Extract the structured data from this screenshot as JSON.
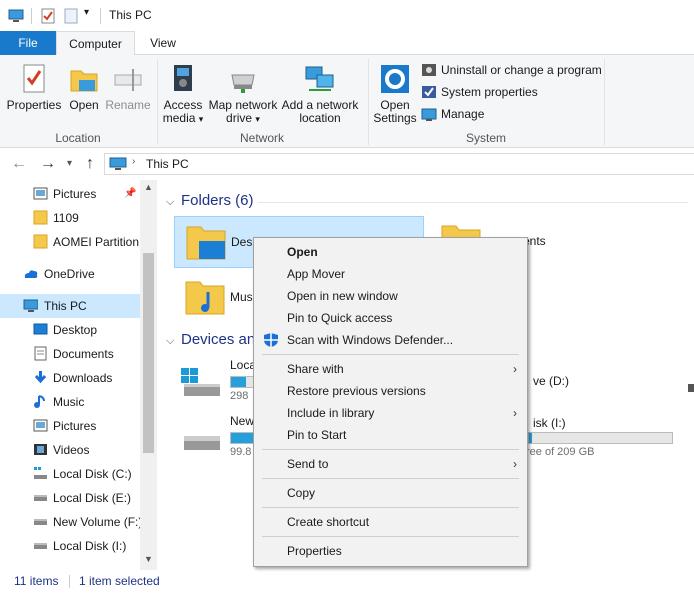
{
  "window": {
    "title": "This PC"
  },
  "ribbon_tabs": [
    "File",
    "Computer",
    "View"
  ],
  "ribbon": {
    "location": {
      "label": "Location",
      "properties": "Properties",
      "open": "Open",
      "rename": "Rename"
    },
    "network": {
      "label": "Network",
      "access_media_1": "Access",
      "access_media_2": "media",
      "map_drive_1": "Map network",
      "map_drive_2": "drive",
      "add_location_1": "Add a network",
      "add_location_2": "location"
    },
    "system": {
      "label": "System",
      "open_settings_1": "Open",
      "open_settings_2": "Settings",
      "uninstall": "Uninstall or change a program",
      "system_properties": "System properties",
      "manage": "Manage"
    }
  },
  "address": {
    "path": "This PC"
  },
  "nav_pane": [
    {
      "label": "Pictures",
      "icon": "pictures-icon"
    },
    {
      "label": "1109",
      "icon": "folder-icon"
    },
    {
      "label": "AOMEI Partition",
      "icon": "folder-icon"
    },
    {
      "label": "OneDrive",
      "icon": "cloud-icon"
    },
    {
      "label": "This PC",
      "icon": "computer-icon"
    },
    {
      "label": "Desktop",
      "icon": "desktop-icon"
    },
    {
      "label": "Documents",
      "icon": "documents-icon"
    },
    {
      "label": "Downloads",
      "icon": "downloads-icon"
    },
    {
      "label": "Music",
      "icon": "music-icon"
    },
    {
      "label": "Pictures",
      "icon": "pictures-icon"
    },
    {
      "label": "Videos",
      "icon": "videos-icon"
    },
    {
      "label": "Local Disk (C:)",
      "icon": "drive-icon"
    },
    {
      "label": "Local Disk (E:)",
      "icon": "drive-icon"
    },
    {
      "label": "New Volume (F:)",
      "icon": "drive-icon"
    },
    {
      "label": "Local Disk (I:)",
      "icon": "drive-icon"
    }
  ],
  "content": {
    "folders_header": "Folders (6)",
    "devices_header": "Devices and",
    "folders": [
      {
        "label": "Desk"
      },
      {
        "label": "ents"
      },
      {
        "label": "Musi"
      }
    ],
    "drives": [
      {
        "label": "Loca",
        "size": "298",
        "used_fraction": 0.08
      },
      {
        "label": "New",
        "size": "99.8",
        "used_fraction": 0.3
      },
      {
        "label": "ve (D:)"
      },
      {
        "label": "isk (I:)",
        "size": "ree of 209 GB",
        "used_fraction": 0.02
      }
    ]
  },
  "context_menu": [
    {
      "label": "Open",
      "bold": true
    },
    {
      "label": "App Mover"
    },
    {
      "label": "Open in new window"
    },
    {
      "label": "Pin to Quick access"
    },
    {
      "label": "Scan with Windows Defender...",
      "icon": "defender-shield-icon"
    },
    {
      "label": "Share with",
      "submenu": true
    },
    {
      "label": "Restore previous versions"
    },
    {
      "label": "Include in library",
      "submenu": true
    },
    {
      "label": "Pin to Start"
    },
    {
      "label": "Send to",
      "submenu": true
    },
    {
      "label": "Copy"
    },
    {
      "label": "Create shortcut"
    },
    {
      "label": "Properties"
    }
  ],
  "status": {
    "items": "11 items",
    "selected": "1 item selected"
  },
  "colors": {
    "accent": "#1979ca",
    "selection": "#cce8ff",
    "header_blue": "#1e3287"
  }
}
